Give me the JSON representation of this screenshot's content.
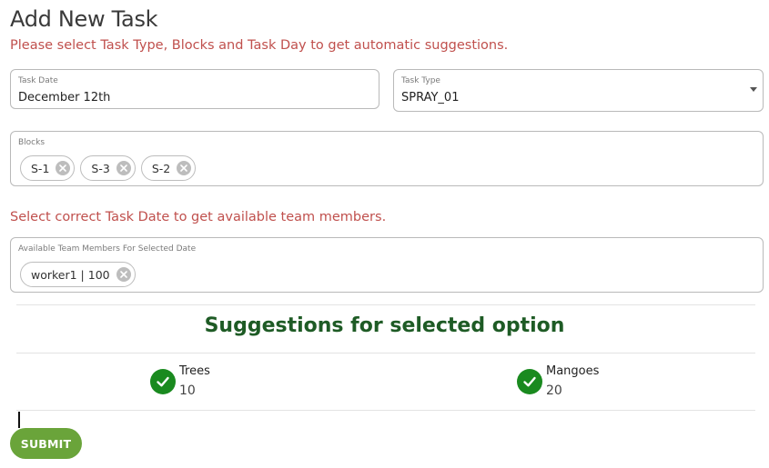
{
  "page": {
    "title": "Add New Task",
    "suggestion_hint": "Please select Task Type, Blocks and Task Day to get automatic suggestions.",
    "team_hint": "Select correct Task Date to get available team members."
  },
  "form": {
    "task_date": {
      "label": "Task Date",
      "value": "December 12th"
    },
    "task_type": {
      "label": "Task Type",
      "value": "SPRAY_01"
    },
    "blocks": {
      "label": "Blocks",
      "chips": [
        "S-1",
        "S-3",
        "S-2"
      ]
    },
    "team": {
      "label": "Available Team Members For Selected Date",
      "chips": [
        "worker1 | 100"
      ]
    }
  },
  "suggestions": {
    "title": "Suggestions for selected option",
    "items": [
      {
        "label": "Trees",
        "value": "10"
      },
      {
        "label": "Mangoes",
        "value": "20"
      }
    ]
  },
  "actions": {
    "submit_label": "SUBMIT"
  },
  "colors": {
    "warning": "#c0504d",
    "heading_green": "#1e5b25",
    "check_green": "#1a8a1f",
    "submit_green": "#6aa43a"
  },
  "icons": {
    "chip_remove": "close-circle-icon",
    "suggestion_item": "check-circle-icon",
    "dropdown": "caret-down-icon"
  }
}
